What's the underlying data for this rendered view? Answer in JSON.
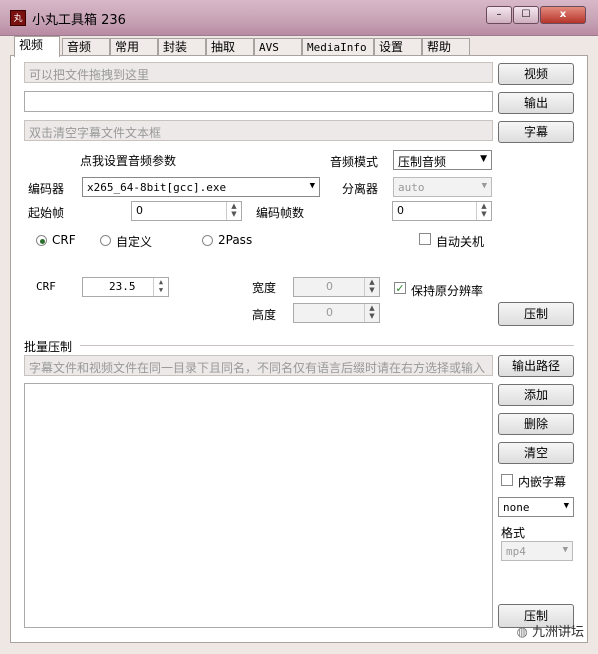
{
  "window": {
    "app_icon": "丸",
    "title": "小丸工具箱 236",
    "minimize": "–",
    "maximize": "☐",
    "close": "x"
  },
  "tabs": [
    "视频",
    "音频",
    "常用",
    "封装",
    "抽取",
    "AVS",
    "MediaInfo",
    "设置",
    "帮助"
  ],
  "video_tab": {
    "video_input_placeholder": "可以把文件拖拽到这里",
    "video_button": "视频",
    "output_button": "输出",
    "subtitle_placeholder": "双击清空字幕文件文本框",
    "subtitle_button": "字幕",
    "audio_settings_link": "点我设置音频参数",
    "audio_mode_label": "音频模式",
    "audio_mode_value": "压制音频",
    "encoder_label": "编码器",
    "encoder_value": "x265_64-8bit[gcc].exe",
    "demuxer_label": "分离器",
    "demuxer_value": "auto",
    "start_frame_label": "起始帧",
    "start_frame_value": "0",
    "encode_frames_label": "编码帧数",
    "encode_frames_value": "0",
    "mode_crf": "CRF",
    "mode_custom": "自定义",
    "mode_2pass": "2Pass",
    "auto_shutdown_label": "自动关机",
    "crf_label": "CRF",
    "crf_value": "23.5",
    "width_label": "宽度",
    "width_value": "0",
    "height_label": "高度",
    "height_value": "0",
    "keep_resolution_label": "保持原分辨率",
    "keep_resolution_checked": "✓",
    "encode_button": "压制",
    "batch_title": "批量压制",
    "batch_hint": "字幕文件和视频文件在同一目录下且同名，不同名仅有语言后缀时请在右方选择或输入",
    "output_path_button": "输出路径",
    "add_button": "添加",
    "delete_button": "删除",
    "clear_button": "清空",
    "embed_sub_label": "内嵌字幕",
    "embed_sub_value": "none",
    "format_label": "格式",
    "format_value": "mp4",
    "batch_encode_button": "压制"
  },
  "watermark": "九洲讲坛"
}
